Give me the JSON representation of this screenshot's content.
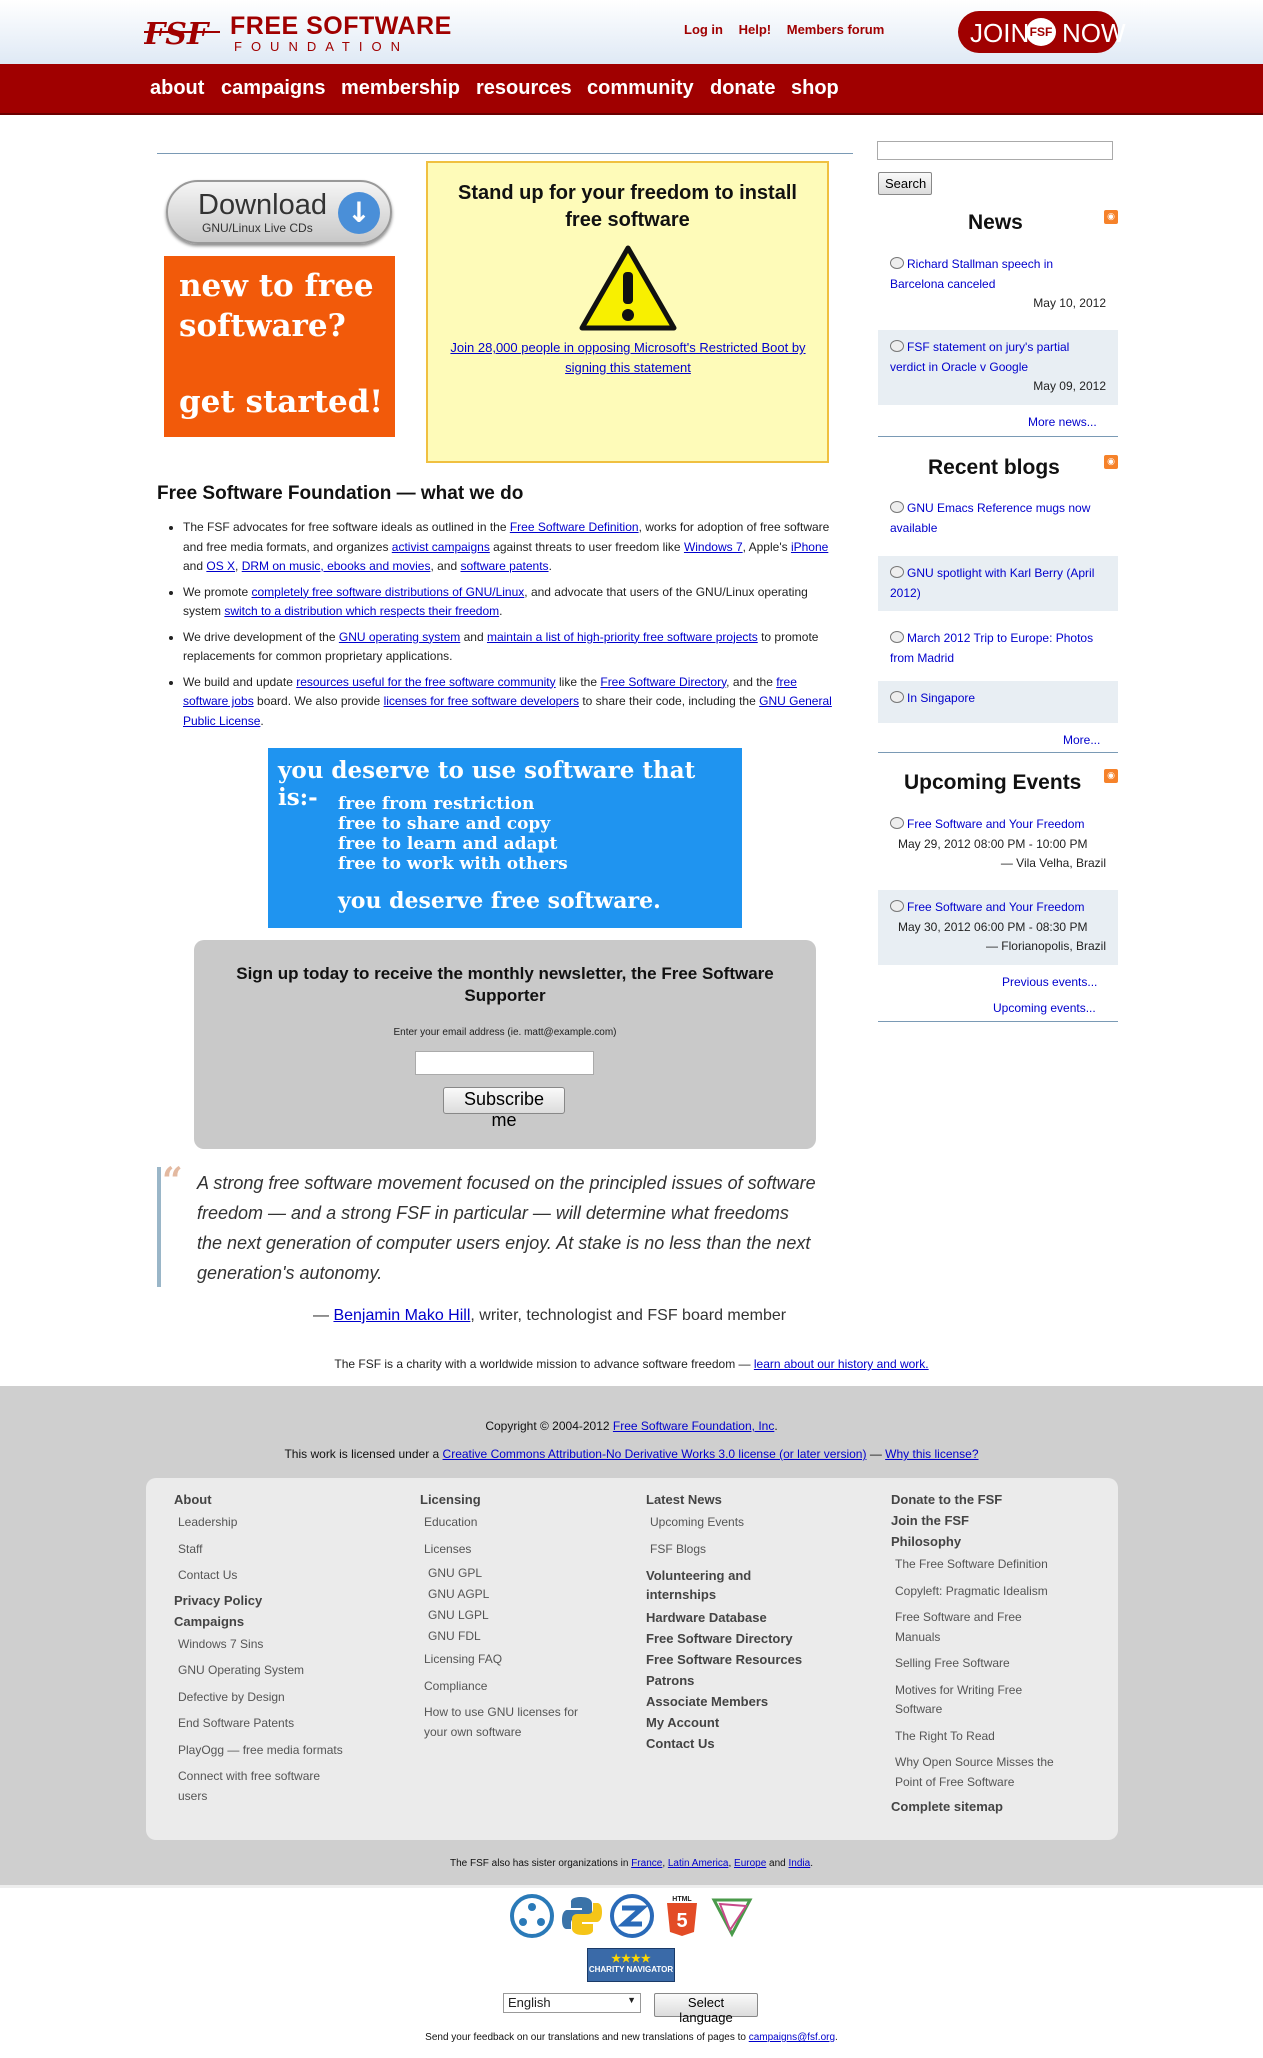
{
  "header": {
    "logo_title": "FREE SOFTWARE",
    "logo_sub": "FOUNDATION",
    "logo_mark": "FSF",
    "toplinks": [
      "Log in",
      "Help!",
      "Members forum"
    ],
    "join_left": "JOIN",
    "join_right": "NOW",
    "join_mark": "FSF"
  },
  "nav": [
    "about",
    "campaigns",
    "membership",
    "resources",
    "community",
    "donate",
    "shop"
  ],
  "download": {
    "title": "Download",
    "subtitle": "GNU/Linux Live CDs",
    "icon": "down-arrow-icon"
  },
  "new_to_free": {
    "line1": "new to free",
    "line2": "software?",
    "line3": "get started!"
  },
  "standup": {
    "title": "Stand up for your freedom to install free software",
    "link": "Join 28,000 people in opposing Microsoft's Restricted Boot by signing this statement"
  },
  "whatwedo": {
    "heading": "Free Software Foundation — what we do",
    "b1": {
      "t1": "The FSF advocates for free software ideals as outlined in the ",
      "l1": "Free Software Definition",
      "t2": ", works for adoption of free software and free media formats, and organizes ",
      "l2": "activist campaigns",
      "t3": " against threats to user freedom like ",
      "l3": "Windows 7",
      "t4": ", Apple's ",
      "l4": "iPhone",
      "t5": " and ",
      "l5": "OS X",
      "t6": ", ",
      "l6": "DRM on music, ebooks and movies",
      "t7": ", and ",
      "l7": "software patents",
      "t8": "."
    },
    "b2": {
      "t1": "We promote ",
      "l1": "completely free software distributions of GNU/Linux",
      "t2": ", and advocate that users of the GNU/Linux operating system ",
      "l2": "switch to a distribution which respects their freedom",
      "t3": "."
    },
    "b3": {
      "t1": "We drive development of the ",
      "l1": "GNU operating system",
      "t2": " and ",
      "l2": "maintain a list of high-priority free software projects",
      "t3": " to promote replacements for common proprietary applications."
    },
    "b4": {
      "t1": "We build and update ",
      "l1": "resources useful for the free software community",
      "t2": " like the ",
      "l2": "Free Software Directory",
      "t3": ", and the ",
      "l3": "free software jobs",
      "t4": " board. We also provide ",
      "l4": "licenses for free software developers",
      "t5": " to share their code, including the ",
      "l5": "GNU General Public License",
      "t6": "."
    }
  },
  "deserve": {
    "title": "you deserve to use software that is:-",
    "lines": [
      "free from restriction",
      "free to share and copy",
      "free to learn and adapt",
      "free to work with others"
    ],
    "closing": "you deserve free software."
  },
  "newsletter": {
    "heading": "Sign up today to receive the monthly newsletter, the Free Software Supporter",
    "email_label": "Enter your email address (ie. matt@example.com)",
    "email_value": "",
    "button": "Subscribe me"
  },
  "quote": {
    "mark": "“",
    "text": "A strong free software movement focused on the principled issues of software freedom — and a strong FSF in particular — will determine what freedoms the next generation of computer users enjoy. At stake is no less than the next generation's autonomy.",
    "dash": "— ",
    "author": "Benjamin Mako Hill",
    "role": ", writer, technologist and FSF board member"
  },
  "charity": {
    "text": "The FSF is a charity with a worldwide mission to advance software freedom — ",
    "link": "learn about our history and work."
  },
  "sidebar": {
    "search_value": "",
    "search_button": "Search",
    "rss_icon": "rss-feed-icon",
    "news_heading": "News",
    "news": [
      {
        "title": "Richard Stallman speech in Barcelona canceled",
        "date": "May 10, 2012"
      },
      {
        "title": "FSF statement on jury's partial verdict in Oracle v Google",
        "date": "May 09, 2012"
      }
    ],
    "news_more": "More news...",
    "blogs_heading": "Recent blogs",
    "blogs": [
      "GNU Emacs Reference mugs now available",
      "GNU spotlight with Karl Berry (April 2012)",
      "March 2012 Trip to Europe: Photos from Madrid",
      "In Singapore"
    ],
    "blogs_more": "More...",
    "events_heading": "Upcoming Events",
    "events": [
      {
        "title": "Free Software and Your Freedom",
        "when": "May 29, 2012 08:00 PM - 10:00 PM",
        "where": "— Vila Velha, Brazil"
      },
      {
        "title": "Free Software and Your Freedom",
        "when": "May 30, 2012 06:00 PM - 08:30 PM",
        "where": "— Florianopolis, Brazil"
      }
    ],
    "events_prev": "Previous events...",
    "events_upcoming": "Upcoming events..."
  },
  "footer": {
    "copy_text": "Copyright © 2004-2012 ",
    "copy_link": "Free Software Foundation, Inc",
    "copy_end": ".",
    "license_text": "This work is licensed under a ",
    "license_link": "Creative Commons Attribution-No Derivative Works 3.0 license (or later version)",
    "license_sep": " — ",
    "why_link": "Why this license?",
    "col1": {
      "about": "About",
      "leadership": "Leadership",
      "staff": "Staff",
      "contact": "Contact Us",
      "privacy": "Privacy Policy",
      "campaigns": "Campaigns",
      "items": [
        "Windows 7 Sins",
        "GNU Operating System",
        "Defective by Design",
        "End Software Patents",
        "PlayOgg — free media formats",
        "Connect with free software users"
      ]
    },
    "col2": {
      "licensing": "Licensing",
      "education": "Education",
      "licenses": "Licenses",
      "sub": [
        "GNU GPL",
        "GNU AGPL",
        "GNU LGPL",
        "GNU FDL"
      ],
      "faq": "Licensing FAQ",
      "compliance": "Compliance",
      "howto": "How to use GNU licenses for your own software"
    },
    "col3": {
      "latest": "Latest News",
      "upcoming": "Upcoming Events",
      "blogs": "FSF Blogs",
      "bold": [
        "Volunteering and internships",
        "Hardware Database",
        "Free Software Directory",
        "Free Software Resources",
        "Patrons",
        "Associate Members",
        "My Account",
        "Contact Us"
      ]
    },
    "col4": {
      "donate": "Donate to the FSF",
      "join": "Join the FSF",
      "philosophy": "Philosophy",
      "items": [
        "The Free Software Definition",
        "Copyleft: Pragmatic Idealism",
        "Free Software and Free Manuals",
        "Selling Free Software",
        "Motives for Writing Free Software",
        "The Right To Read",
        "Why Open Source Misses the Point of Free Software"
      ],
      "sitemap": "Complete sitemap"
    },
    "sister": {
      "t1": "The FSF also has sister organizations in ",
      "l1": "France",
      "t2": ", ",
      "l2": "Latin America",
      "t3": ", ",
      "l3": "Europe",
      "t4": " and ",
      "l4": "India",
      "t5": "."
    },
    "badges": [
      "network-icon",
      "python-icon",
      "zend-icon",
      "html5-icon",
      "divine-icon"
    ],
    "html5_label": "HTML",
    "html5_num": "5",
    "charnav": "CHARITY NAVIGATOR",
    "charnav_stars": "★★★★",
    "language": "English",
    "lang_button": "Select language",
    "feedback_text": "Send your feedback on our translations and new translations of pages to ",
    "feedback_link": "campaigns@fsf.org",
    "feedback_end": "."
  }
}
